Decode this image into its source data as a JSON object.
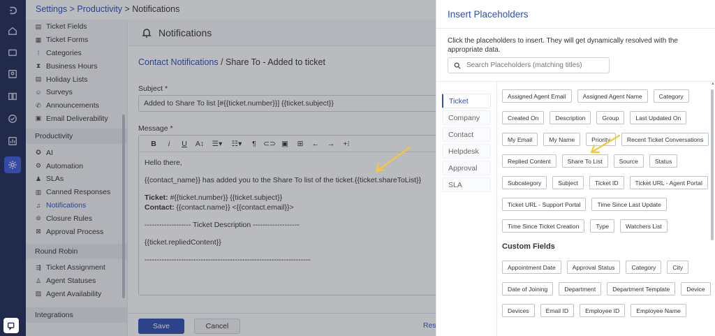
{
  "breadcrumb": {
    "settings": "Settings",
    "sep1": " > ",
    "productivity": "Productivity",
    "sep2": " > ",
    "current": "Notifications"
  },
  "sidebar": {
    "items_top": [
      {
        "label": "Ticket Fields",
        "icon": "list-icon"
      },
      {
        "label": "Ticket Forms",
        "icon": "form-icon"
      },
      {
        "label": "Categories",
        "icon": "category-icon"
      },
      {
        "label": "Business Hours",
        "icon": "hourglass-icon"
      },
      {
        "label": "Holiday Lists",
        "icon": "list-icon"
      },
      {
        "label": "Surveys",
        "icon": "smiley-icon"
      },
      {
        "label": "Announcements",
        "icon": "megaphone-icon"
      },
      {
        "label": "Email Deliverability",
        "icon": "email-icon"
      }
    ],
    "section_productivity": "Productivity",
    "items_productivity": [
      {
        "label": "AI",
        "icon": "ai-icon"
      },
      {
        "label": "Automation",
        "icon": "automation-icon"
      },
      {
        "label": "SLAs",
        "icon": "sla-icon"
      },
      {
        "label": "Canned Responses",
        "icon": "canned-icon"
      },
      {
        "label": "Notifications",
        "icon": "bell-icon",
        "active": true
      },
      {
        "label": "Closure Rules",
        "icon": "closure-icon"
      },
      {
        "label": "Approval Process",
        "icon": "approval-icon"
      }
    ],
    "section_round_robin": "Round Robin",
    "items_round_robin": [
      {
        "label": "Ticket Assignment",
        "icon": "assignment-icon"
      },
      {
        "label": "Agent Statuses",
        "icon": "status-icon"
      },
      {
        "label": "Agent Availability",
        "icon": "availability-icon"
      }
    ],
    "section_integrations": "Integrations"
  },
  "page": {
    "title": "Notifications",
    "sub_link": "Contact Notifications",
    "sub_rest": " / Share To - Added to ticket",
    "subject_label": "Subject *",
    "subject_value": "Added to Share To list [#{{ticket.number}}] {{ticket.subject}}",
    "message_label": "Message *"
  },
  "editor": {
    "line1": "Hello there,",
    "line2": "{{contact_name}} has added you to the Share To list of the ticket.{{ticket.shareToList}}",
    "ticket_label": "Ticket:",
    "ticket_value": " #{{ticket.number}} {{ticket.subject}}",
    "contact_label": "Contact:",
    "contact_value": " {{contact.name}} <{{contact.email}}>",
    "desc_line": "------------------- Ticket Description -------------------",
    "replied": "{{ticket.repliedContent}}",
    "rule": "--------------------------------------------------------------------"
  },
  "footer": {
    "save": "Save",
    "cancel": "Cancel",
    "reset": "Rese"
  },
  "panel": {
    "title": "Insert Placeholders",
    "description": "Click the placeholders to insert. They will get dynamically resolved with the appropriate data.",
    "search_placeholder": "Search Placeholders (matching titles)",
    "categories": [
      "Ticket",
      "Company",
      "Contact",
      "Helpdesk",
      "Approval",
      "SLA"
    ],
    "active_category": "Ticket",
    "ticket_placeholders": [
      [
        "Assigned Agent Email",
        "Assigned Agent Name",
        "Category"
      ],
      [
        "Created On",
        "Description",
        "Group",
        "Last Updated On"
      ],
      [
        "My Email",
        "My Name",
        "Priority",
        "Recent Ticket Conversations"
      ],
      [
        "Replied Content",
        "Share To List",
        "Source",
        "Status"
      ],
      [
        "Subcategory",
        "Subject",
        "Ticket ID",
        "Ticket URL - Agent Portal"
      ],
      [
        "Ticket URL - Support Portal",
        "Time Since Last Update"
      ],
      [
        "Time Since Ticket Creation",
        "Type",
        "Watchers List"
      ]
    ],
    "custom_fields_title": "Custom Fields",
    "custom_placeholders": [
      [
        "Appointment Date",
        "Approval Status",
        "Category",
        "City"
      ],
      [
        "Date of Joining",
        "Department",
        "Department Template",
        "Device"
      ],
      [
        "Devices",
        "Email ID",
        "Employee ID",
        "Employee Name"
      ]
    ]
  },
  "colors": {
    "accent": "#2f4fb0",
    "rail": "#1e2a55",
    "annotation": "#f5c83a"
  }
}
